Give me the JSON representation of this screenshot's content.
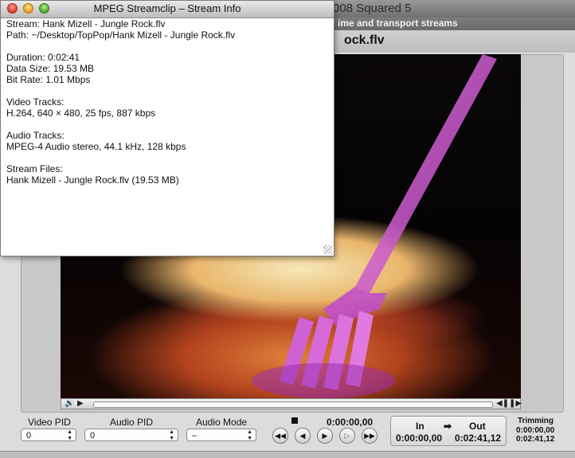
{
  "main_window": {
    "title": "008 Squared 5",
    "subtitle": "ime and transport streams",
    "filename": "ock.flv"
  },
  "controls": {
    "video_pid": {
      "label": "Video PID",
      "value": "0"
    },
    "audio_pid": {
      "label": "Audio PID",
      "value": "0"
    },
    "audio_mode": {
      "label": "Audio Mode",
      "value": "–"
    },
    "current_time": "0:00:00,00",
    "in_label": "In",
    "out_label": "Out",
    "in_time": "0:00:00,00",
    "out_time": "0:02:41,12",
    "trimming_label": "Trimming",
    "trimming_start": "0:00:00,00",
    "trimming_end": "0:02:41,12"
  },
  "info_window": {
    "title": "MPEG Streamclip – Stream Info",
    "stream": "Stream: Hank Mizell - Jungle Rock.flv",
    "path": "Path: ~/Desktop/TopPop/Hank Mizell - Jungle Rock.flv",
    "duration": "Duration: 0:02:41",
    "data_size": "Data Size: 19.53 MB",
    "bit_rate": "Bit Rate: 1.01 Mbps",
    "video_tracks_header": "Video Tracks:",
    "video_track": "H.264, 640 × 480, 25 fps, 887 kbps",
    "audio_tracks_header": "Audio Tracks:",
    "audio_track": "MPEG-4 Audio stereo, 44.1 kHz, 128 kbps",
    "stream_files_header": "Stream Files:",
    "stream_file": "Hank Mizell - Jungle Rock.flv (19.53 MB)"
  },
  "icons": {
    "volume": "speaker-icon",
    "play_small": "play-icon",
    "rewind": "rewind-icon",
    "step_back": "step-back-icon",
    "play": "play-icon",
    "step_forward": "step-forward-icon",
    "fast_forward": "fast-forward-icon",
    "stop": "stop-icon",
    "arrow": "right-arrow-icon"
  }
}
